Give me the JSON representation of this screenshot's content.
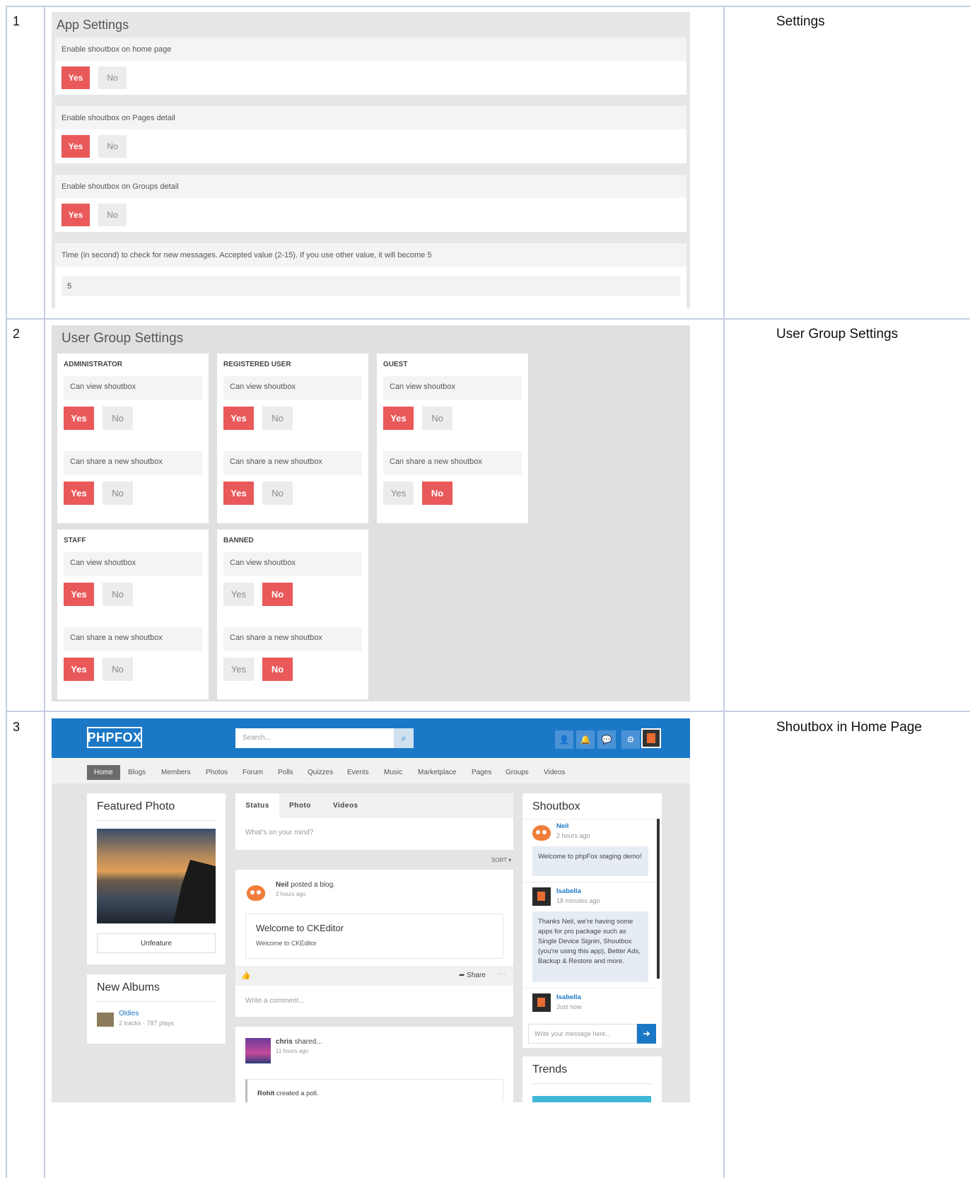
{
  "rows": [
    {
      "num": "1",
      "caption": "Settings"
    },
    {
      "num": "2",
      "caption": "User Group Settings"
    },
    {
      "num": "3",
      "caption": "Shoutbox in Home Page"
    }
  ],
  "app_settings": {
    "title": "App Settings",
    "items": [
      {
        "label": "Enable shoutbox on home page",
        "yes": "Yes",
        "no": "No"
      },
      {
        "label": "Enable shoutbox on Pages detail",
        "yes": "Yes",
        "no": "No"
      },
      {
        "label": "Enable shoutbox on Groups detail",
        "yes": "Yes",
        "no": "No"
      }
    ],
    "time_label": "Time (in second) to check for new messages. Accepted value (2-15). If you use other value, it will become 5",
    "time_value": "5"
  },
  "user_group": {
    "title": "User Group Settings",
    "view_label": "Can view shoutbox",
    "share_label": "Can share a new shoutbox",
    "yes": "Yes",
    "no": "No",
    "groups": [
      {
        "name": "ADMINISTRATOR",
        "view": "yes",
        "share": "yes"
      },
      {
        "name": "REGISTERED USER",
        "view": "yes",
        "share": "yes"
      },
      {
        "name": "GUEST",
        "view": "yes",
        "share": "no"
      },
      {
        "name": "STAFF",
        "view": "yes",
        "share": "yes"
      },
      {
        "name": "BANNED",
        "view": "no",
        "share": "no"
      }
    ]
  },
  "home": {
    "logo": "PHPFOX",
    "search_placeholder": "Search...",
    "nav": [
      "Home",
      "Blogs",
      "Members",
      "Photos",
      "Forum",
      "Polls",
      "Quizzes",
      "Events",
      "Music",
      "Marketplace",
      "Pages",
      "Groups",
      "Videos"
    ],
    "featured_title": "Featured Photo",
    "unfeature": "Unfeature",
    "albums_title": "New Albums",
    "album_name": "Oldies",
    "album_meta": "2 tracks · 787 plays",
    "tabs": [
      "Status",
      "Photo",
      "Videos"
    ],
    "status_placeholder": "What's on your mind?",
    "sort": "SORT ▾",
    "post_author": "Neil",
    "post_action": " posted a blog.",
    "post_time": "2 hours ago",
    "blog_title": "Welcome to CKEditor",
    "blog_body": "Welcome to CKEditor",
    "share": "Share",
    "comment_placeholder": "Write a comment...",
    "post2_author": "chris",
    "post2_action": " shared...",
    "post2_time": "11 hours ago",
    "poll_author": "Rohit",
    "poll_action": " created a poll.",
    "shoutbox_title": "Shoutbox",
    "msgs": [
      {
        "name": "Neil",
        "time": "2 hours ago",
        "text": "Welcome to phpFox staging demo!"
      },
      {
        "name": "Isabella",
        "time": "18 minutes ago",
        "text": "Thanks Neil, we're having some apps for pro package such as Single Device Signin, Shoutbox (you're using this app), Better Ads, Backup & Restore and more."
      },
      {
        "name": "Isabella",
        "time": "Just now",
        "text": ""
      }
    ],
    "message_placeholder": "Write your message here...",
    "trends_title": "Trends"
  },
  "colors": {
    "accent": "#e9595a",
    "brand": "#1b78c6"
  }
}
